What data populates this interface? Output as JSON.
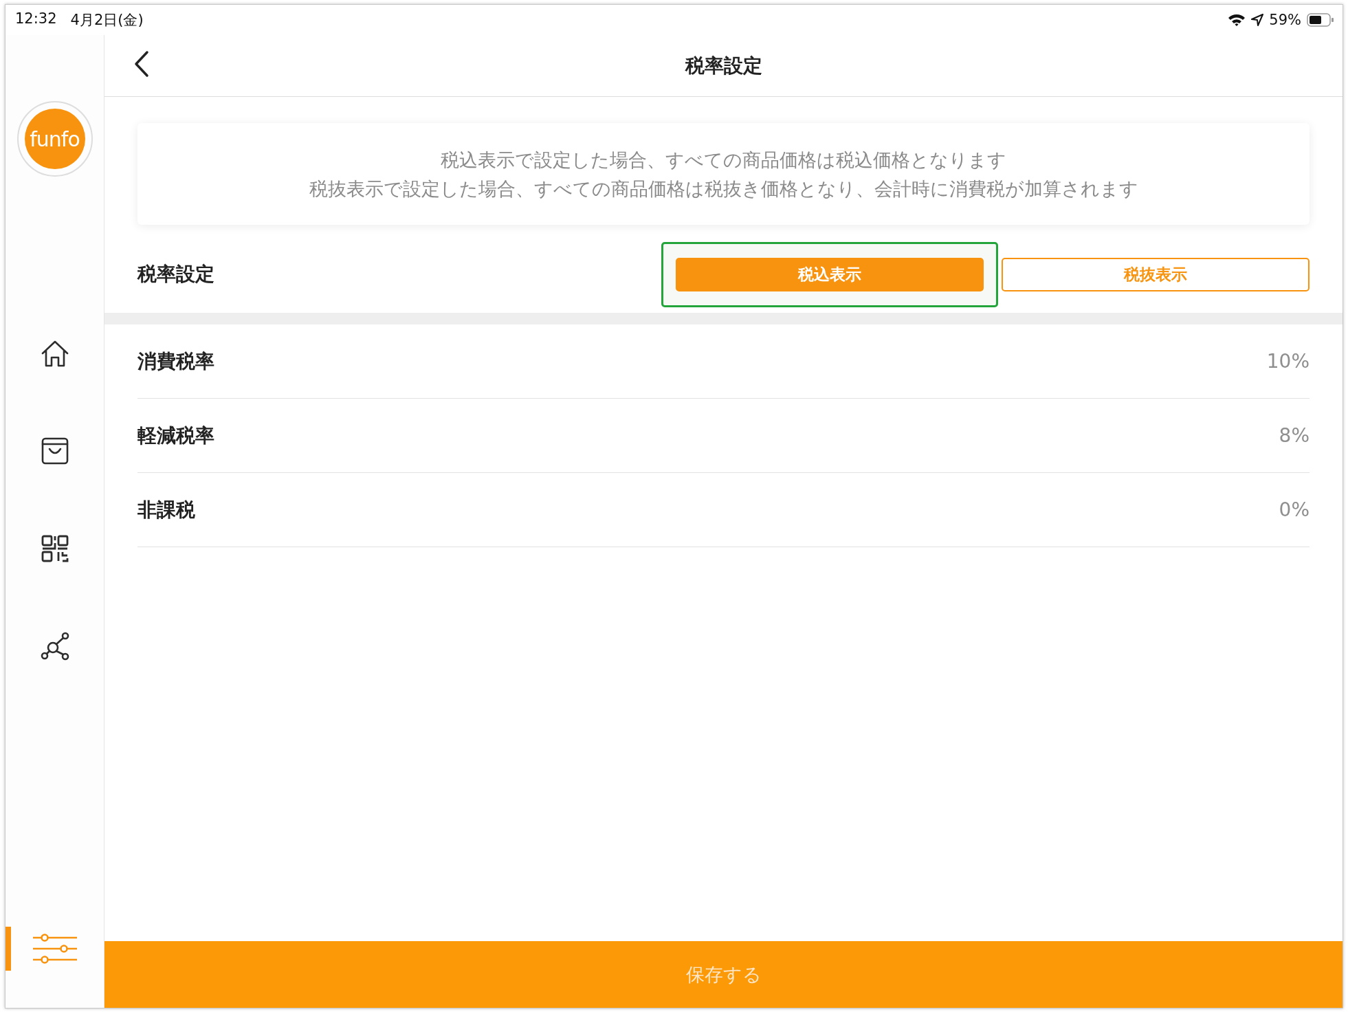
{
  "status_bar": {
    "time": "12:32",
    "date": "4月2日(金)",
    "battery": "59%"
  },
  "sidebar": {
    "logo": "funfo",
    "items": [
      {
        "kind": "home",
        "selected": false
      },
      {
        "kind": "bag",
        "selected": false
      },
      {
        "kind": "qr",
        "selected": false
      },
      {
        "kind": "network",
        "selected": false
      },
      {
        "kind": "sliders",
        "selected": true
      }
    ]
  },
  "header": {
    "title": "税率設定"
  },
  "notice": {
    "lines": [
      "税込表示で設定した場合、すべての商品価格は税込価格となります",
      "税抜表示で設定した場合、すべての商品価格は税抜き価格となり、会計時に消費税が加算されます"
    ]
  },
  "tax_display": {
    "label": "税率設定",
    "options": [
      {
        "label": "税込表示",
        "selected": true,
        "highlighted": true
      },
      {
        "label": "税抜表示",
        "selected": false,
        "highlighted": false
      }
    ]
  },
  "rates": [
    {
      "name": "消費税率",
      "value": "10%"
    },
    {
      "name": "軽減税率",
      "value": "8%"
    },
    {
      "name": "非課税",
      "value": "0%"
    }
  ],
  "save_button": "保存する"
}
